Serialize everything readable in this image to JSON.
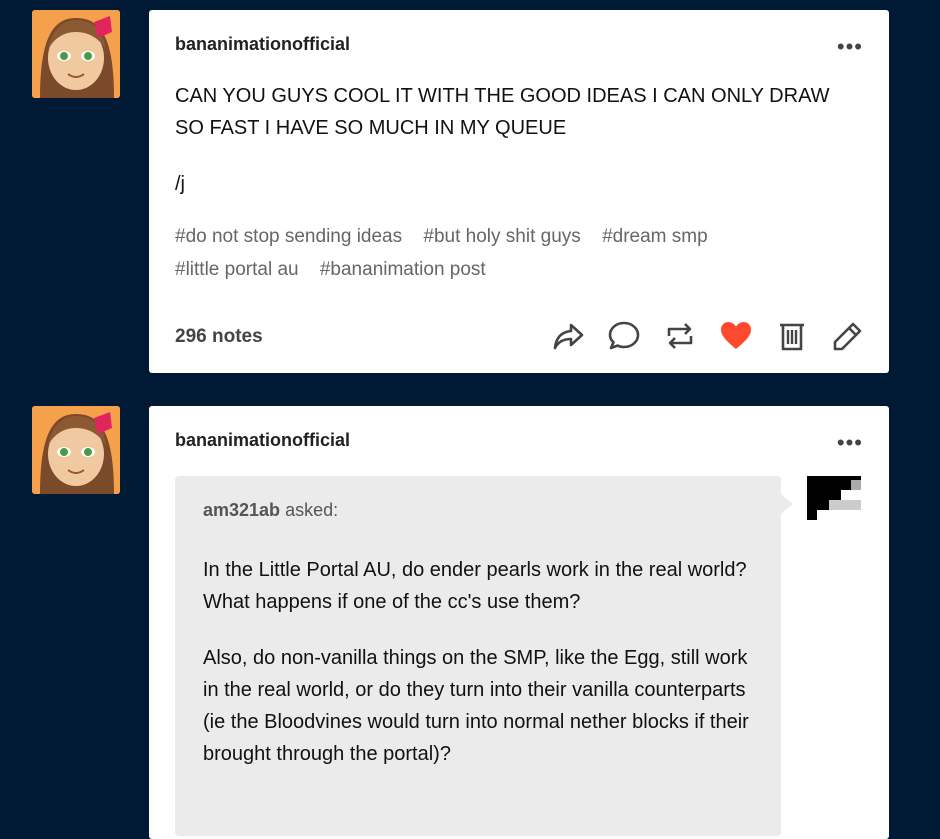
{
  "posts": [
    {
      "blog_name": "bananimationofficial",
      "more_label": "•••",
      "body": "CAN YOU GUYS COOL IT WITH THE GOOD IDEAS I CAN ONLY DRAW SO FAST I HAVE SO MUCH IN MY QUEUE",
      "body_2": "/j",
      "tags": [
        "#do not stop sending ideas",
        "#but holy shit guys",
        "#dream smp",
        "#little portal au",
        "#bananimation post"
      ],
      "notes": "296 notes",
      "actions": [
        "share-icon",
        "reply-icon",
        "reblog-icon",
        "like-icon",
        "delete-icon",
        "edit-icon"
      ],
      "liked_color": "#ff4930"
    },
    {
      "blog_name": "bananimationofficial",
      "more_label": "•••",
      "asker": "am321ab",
      "asked_label": "asked:",
      "question_p1": "In the Little Portal AU, do ender pearls work in the real world? What happens if one of the cc's use them?",
      "question_p2": "Also, do non-vanilla things on the SMP, like the Egg, still work in the real world, or do they turn into their vanilla counterparts (ie the Bloodvines would turn into normal nether blocks if their brought through the portal)?"
    }
  ],
  "colors": {
    "background": "#001935",
    "avatar_bg": "#f5a04a",
    "ask_bg": "#ebebeb"
  }
}
